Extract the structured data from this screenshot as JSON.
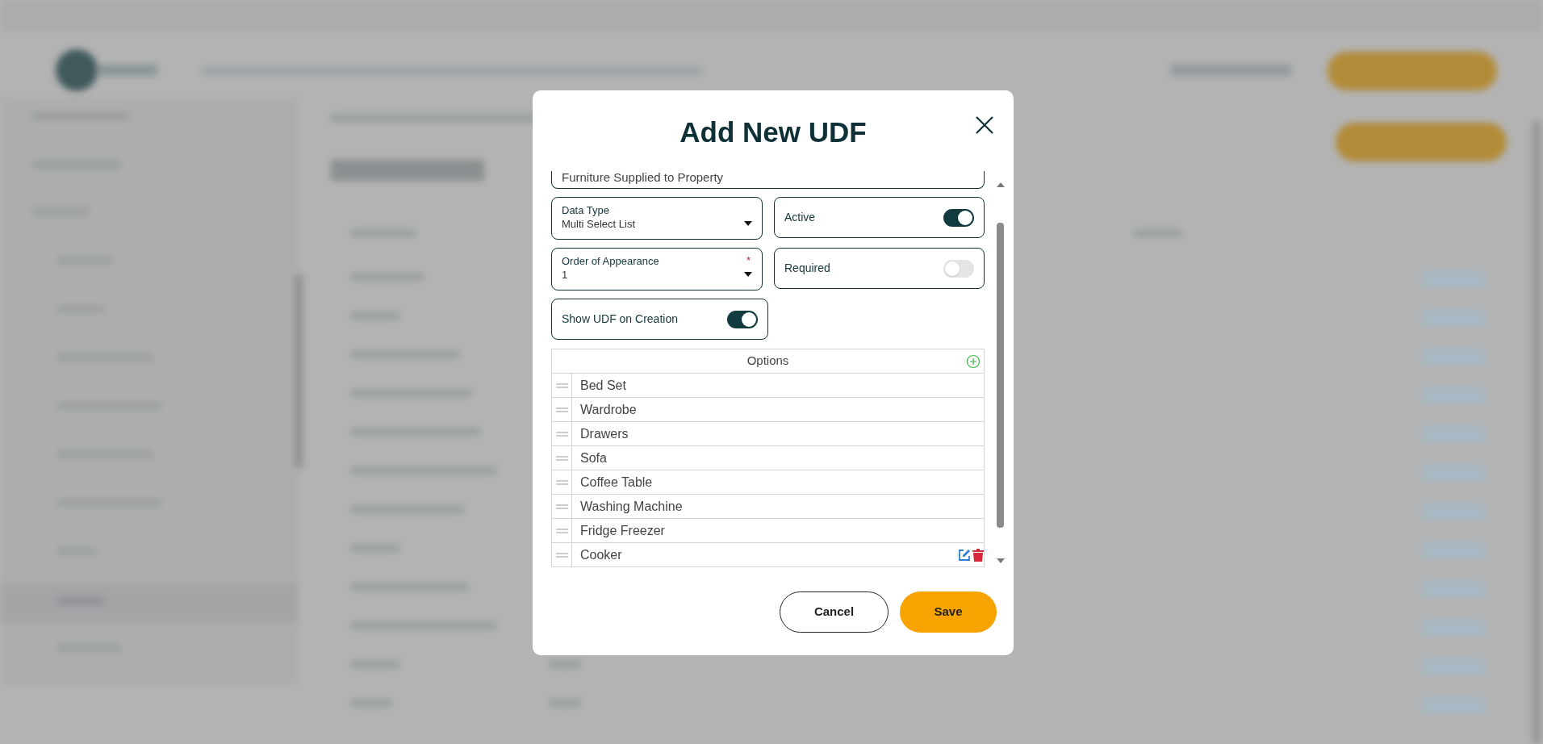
{
  "dialog": {
    "title": "Add New UDF",
    "name_field": {
      "value": "Furniture Supplied to Property"
    },
    "data_type": {
      "label": "Data Type",
      "value": "Multi Select List"
    },
    "order": {
      "label": "Order of Appearance",
      "value": "1",
      "required_marker": "*"
    },
    "toggles": [
      {
        "label": "Active",
        "on": true
      },
      {
        "label": "Required",
        "on": false
      },
      {
        "label": "Show UDF on Creation",
        "on": true
      }
    ],
    "options": {
      "header": "Options",
      "items": [
        {
          "label": "Bed Set",
          "hovered": false
        },
        {
          "label": "Wardrobe",
          "hovered": false
        },
        {
          "label": "Drawers",
          "hovered": false
        },
        {
          "label": "Sofa",
          "hovered": false
        },
        {
          "label": "Coffee Table",
          "hovered": false
        },
        {
          "label": "Washing Machine",
          "hovered": false
        },
        {
          "label": "Fridge Freezer",
          "hovered": false
        },
        {
          "label": "Cooker",
          "hovered": true
        }
      ]
    },
    "buttons": [
      {
        "label": "Cancel",
        "kind": "secondary"
      },
      {
        "label": "Save",
        "kind": "primary"
      }
    ]
  }
}
